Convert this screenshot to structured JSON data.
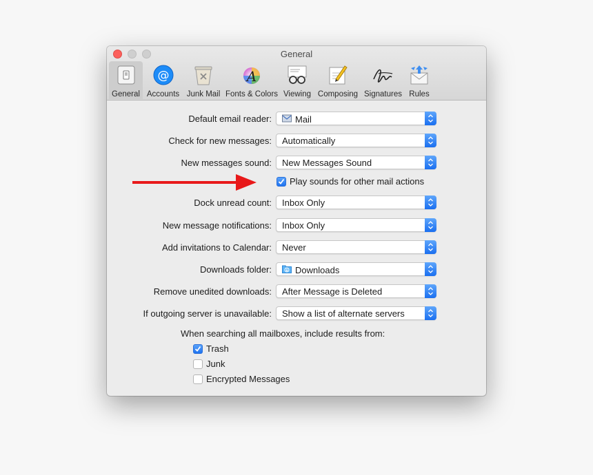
{
  "window": {
    "title": "General"
  },
  "toolbar": {
    "items": [
      {
        "label": "General",
        "icon": "general-switch-icon",
        "selected": true
      },
      {
        "label": "Accounts",
        "icon": "at-sign-icon"
      },
      {
        "label": "Junk Mail",
        "icon": "trash-bin-icon"
      },
      {
        "label": "Fonts & Colors",
        "icon": "color-wheel-icon"
      },
      {
        "label": "Viewing",
        "icon": "glasses-icon"
      },
      {
        "label": "Composing",
        "icon": "pencil-paper-icon"
      },
      {
        "label": "Signatures",
        "icon": "signature-icon"
      },
      {
        "label": "Rules",
        "icon": "envelope-arrows-icon"
      }
    ]
  },
  "settings": {
    "default_email_reader": {
      "label": "Default email reader:",
      "value": "Mail",
      "icon": "mail-app-icon"
    },
    "check_new_messages": {
      "label": "Check for new messages:",
      "value": "Automatically"
    },
    "new_messages_sound": {
      "label": "New messages sound:",
      "value": "New Messages Sound"
    },
    "play_sounds": {
      "label": "Play sounds for other mail actions",
      "checked": true
    },
    "dock_unread_count": {
      "label": "Dock unread count:",
      "value": "Inbox Only"
    },
    "new_message_notifications": {
      "label": "New message notifications:",
      "value": "Inbox Only"
    },
    "add_invitations": {
      "label": "Add invitations to Calendar:",
      "value": "Never"
    },
    "downloads_folder": {
      "label": "Downloads folder:",
      "value": "Downloads",
      "icon": "downloads-folder-icon"
    },
    "remove_unedited": {
      "label": "Remove unedited downloads:",
      "value": "After Message is Deleted"
    },
    "outgoing_server": {
      "label": "If outgoing server is unavailable:",
      "value": "Show a list of alternate servers"
    }
  },
  "search": {
    "heading": "When searching all mailboxes, include results from:",
    "options": [
      {
        "label": "Trash",
        "checked": true
      },
      {
        "label": "Junk",
        "checked": false
      },
      {
        "label": "Encrypted Messages",
        "checked": false
      }
    ]
  },
  "help": {
    "glyph": "?"
  },
  "colors": {
    "accent": "#1f73f0",
    "arrow": "#e8191a"
  }
}
